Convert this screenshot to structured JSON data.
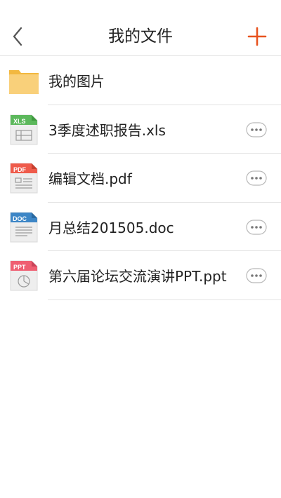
{
  "header": {
    "title": "我的文件",
    "back_icon": "chevron-left-icon",
    "add_icon": "plus-icon",
    "accent_color": "#e8531f"
  },
  "files": [
    {
      "name": "我的图片",
      "type": "folder",
      "icon": "folder-icon",
      "color": "#f6c45a"
    },
    {
      "name": "3季度述职报告.xls",
      "type": "xls",
      "icon_label": "XLS",
      "icon": "spreadsheet-icon",
      "color": "#5cb85c"
    },
    {
      "name": "编辑文档.pdf",
      "type": "pdf",
      "icon_label": "PDF",
      "icon": "pdf-icon",
      "color": "#ef5b4b"
    },
    {
      "name": "月总结201505.doc",
      "type": "doc",
      "icon_label": "DOC",
      "icon": "document-icon",
      "color": "#3d86c6"
    },
    {
      "name": "第六届论坛交流演讲PPT.ppt",
      "type": "ppt",
      "icon_label": "PPT",
      "icon": "presentation-icon",
      "color": "#ef5f72"
    }
  ]
}
